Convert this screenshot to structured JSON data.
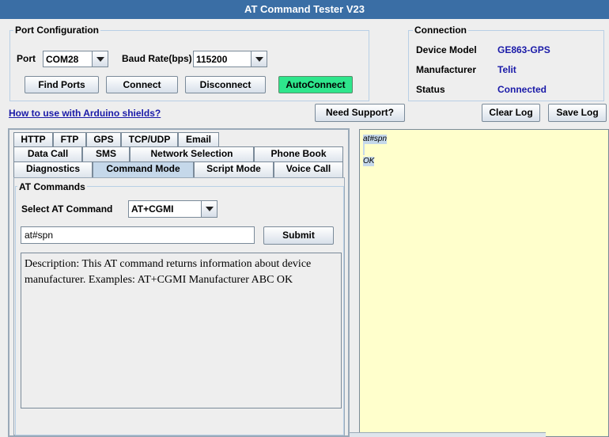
{
  "window": {
    "title": "AT Command Tester V23"
  },
  "port_config": {
    "legend": "Port Configuration",
    "port_label": "Port",
    "port_value": "COM28",
    "baud_label": "Baud Rate(bps)",
    "baud_value": "115200",
    "find_ports": "Find Ports",
    "connect": "Connect",
    "disconnect": "Disconnect",
    "autoconnect": "AutoConnect"
  },
  "connection": {
    "legend": "Connection",
    "device_model_label": "Device Model",
    "device_model_value": "GE863-GPS",
    "manufacturer_label": "Manufacturer",
    "manufacturer_value": "Telit",
    "status_label": "Status",
    "status_value": "Connected"
  },
  "toolbar": {
    "arduino_link": "How to use with Arduino shields?",
    "need_support": "Need Support?",
    "clear_log": "Clear Log",
    "save_log": "Save Log"
  },
  "tabs": {
    "row1": [
      "HTTP",
      "FTP",
      "GPS",
      "TCP/UDP",
      "Email"
    ],
    "row2": [
      "Data Call",
      "SMS",
      "Network Selection",
      "Phone Book"
    ],
    "row3": [
      "Diagnostics",
      "Command Mode",
      "Script Mode",
      "Voice Call"
    ],
    "selected": "Command Mode"
  },
  "at_commands": {
    "legend": "AT Commands",
    "select_label": "Select AT Command",
    "select_value": "AT+CGMI",
    "input_value": "at#spn",
    "submit": "Submit",
    "description": "Description: This AT command returns information about device manufacturer. Examples: AT+CGMI Manufacturer ABC OK"
  },
  "log": {
    "lines": [
      "at#spn",
      "OK"
    ]
  },
  "colors": {
    "titlebar": "#3a6ea5",
    "value_text": "#1a1aa8",
    "autoconnect": "#2ee68c",
    "log_background": "#ffffcc",
    "selection": "#c5d8ea"
  }
}
